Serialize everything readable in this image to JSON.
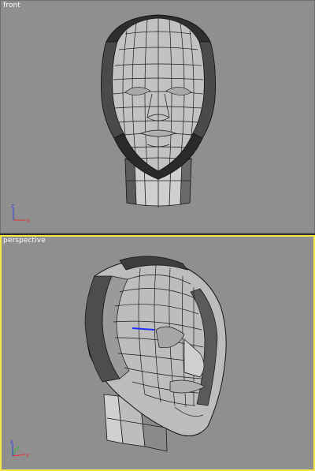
{
  "viewports": {
    "front": {
      "label": "front",
      "active": false
    },
    "perspective": {
      "label": "perspective",
      "active": true
    }
  },
  "axis": {
    "x_label": "x",
    "y_label": "y",
    "z_label": "z"
  },
  "colors": {
    "viewport_bg": "#8f8f8f",
    "active_border": "#f3e84a",
    "mesh_fill": "#c4c4c4",
    "mesh_dark": "#3a3a3a",
    "wire": "#1a1a1a",
    "selected_edge": "#1f2fff",
    "axis_x": "#e23030",
    "axis_y": "#2fb82f",
    "axis_z": "#3040e0"
  }
}
